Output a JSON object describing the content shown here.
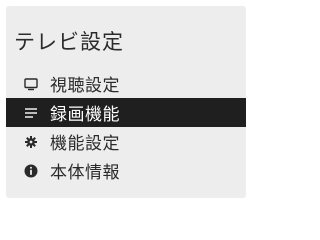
{
  "menu": {
    "title": "テレビ設定",
    "items": [
      {
        "label": "視聴設定",
        "icon": "tv-icon",
        "active": false
      },
      {
        "label": "録画機能",
        "icon": "list-icon",
        "active": true
      },
      {
        "label": "機能設定",
        "icon": "gear-icon",
        "active": false
      },
      {
        "label": "本体情報",
        "icon": "info-icon",
        "active": false
      }
    ]
  },
  "colors": {
    "panel_background": "#ededed",
    "text": "#2a2a2a",
    "selected_background": "#1f1f1f",
    "selected_text": "#ffffff"
  }
}
